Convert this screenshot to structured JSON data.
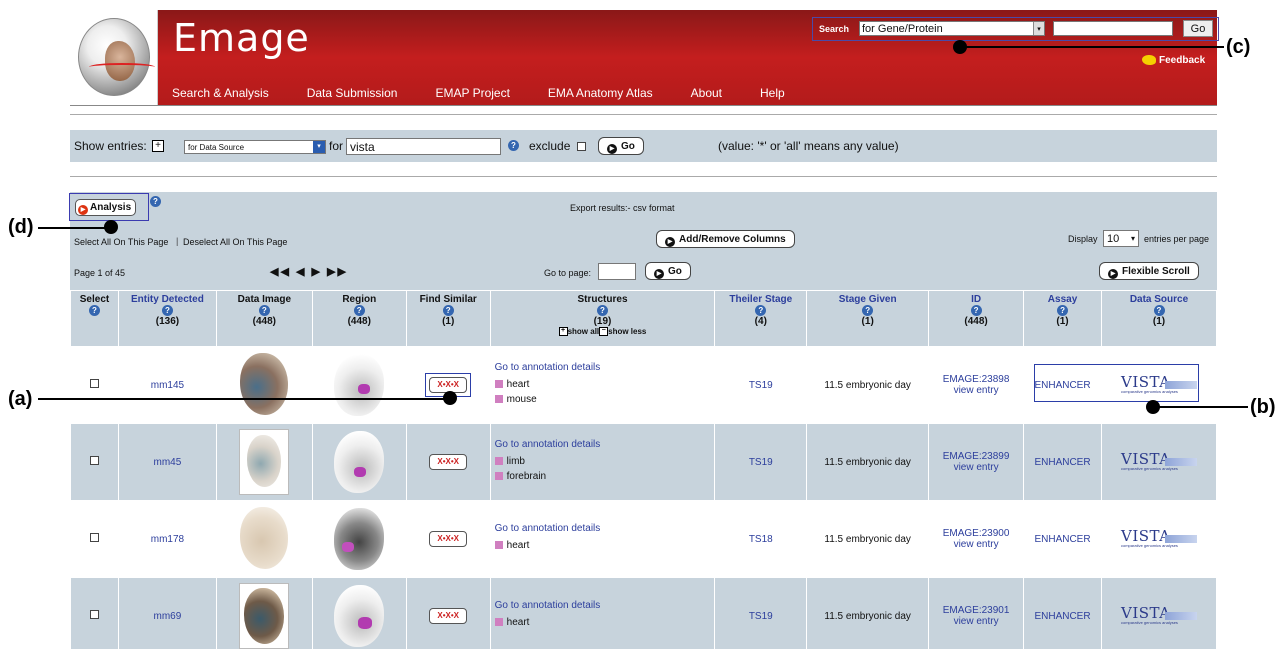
{
  "header": {
    "brand": "Emage",
    "nav": [
      "Search & Analysis",
      "Data Submission",
      "EMAP Project",
      "EMA Anatomy Atlas",
      "About",
      "Help"
    ],
    "search": {
      "label": "Search",
      "selected": "for Gene/Protein",
      "go": "Go"
    },
    "feedback": "Feedback"
  },
  "filter": {
    "show_entries": "Show entries:",
    "source_select": "for Data Source",
    "for_label": "for",
    "value": "vista",
    "exclude": "exclude",
    "go": "Go",
    "hint": "(value: '*' or 'all' means any value)"
  },
  "results": {
    "analysis_btn": "Analysis",
    "export": "Export results:- csv format",
    "select_all": "Select All On This Page",
    "deselect_all": "Deselect All On This Page",
    "add_remove": "Add/Remove Columns",
    "display": "Display",
    "per_page_value": "10",
    "per_page_suffix": "entries per page",
    "page_info": "Page 1 of 45",
    "goto_page": "Go to page:",
    "go": "Go",
    "flexible_scroll": "Flexible Scroll",
    "pager_symbols": "◀◀ ◀ ▶ ▶▶"
  },
  "columns": [
    {
      "title": "Select",
      "count": ""
    },
    {
      "title": "Entity Detected",
      "count": "(136)"
    },
    {
      "title": "Data Image",
      "count": "(448)"
    },
    {
      "title": "Region",
      "count": "(448)"
    },
    {
      "title": "Find Similar",
      "count": "(1)"
    },
    {
      "title": "Structures",
      "count": "(19)"
    },
    {
      "title": "Theiler Stage",
      "count": "(4)"
    },
    {
      "title": "Stage Given",
      "count": "(1)"
    },
    {
      "title": "ID",
      "count": "(448)"
    },
    {
      "title": "Assay",
      "count": "(1)"
    },
    {
      "title": "Data Source",
      "count": "(1)"
    }
  ],
  "show_all": "show all",
  "show_less": "show less",
  "rows": [
    {
      "entity": "mm145",
      "goto": "Go to annotation details",
      "structures": [
        "heart",
        "mouse"
      ],
      "ts": "TS19",
      "stage": "11.5 embryonic day",
      "id": "EMAGE:23898",
      "view": "view entry",
      "assay": "ENHANCER",
      "source": "VISTA"
    },
    {
      "entity": "mm45",
      "goto": "Go to annotation details",
      "structures": [
        "limb",
        "forebrain"
      ],
      "ts": "TS19",
      "stage": "11.5 embryonic day",
      "id": "EMAGE:23899",
      "view": "view entry",
      "assay": "ENHANCER",
      "source": "VISTA"
    },
    {
      "entity": "mm178",
      "goto": "Go to annotation details",
      "structures": [
        "heart"
      ],
      "ts": "TS18",
      "stage": "11.5 embryonic day",
      "id": "EMAGE:23900",
      "view": "view entry",
      "assay": "ENHANCER",
      "source": "VISTA"
    },
    {
      "entity": "mm69",
      "goto": "Go to annotation details",
      "structures": [
        "heart"
      ],
      "ts": "TS19",
      "stage": "11.5 embryonic day",
      "id": "EMAGE:23901",
      "view": "view entry",
      "assay": "ENHANCER",
      "source": "VISTA"
    }
  ],
  "vista_sub": "comparative genomics analyses",
  "find_similar_label": "X•X•X",
  "annotations": {
    "a": "(a)",
    "b": "(b)",
    "c": "(c)",
    "d": "(d)"
  }
}
